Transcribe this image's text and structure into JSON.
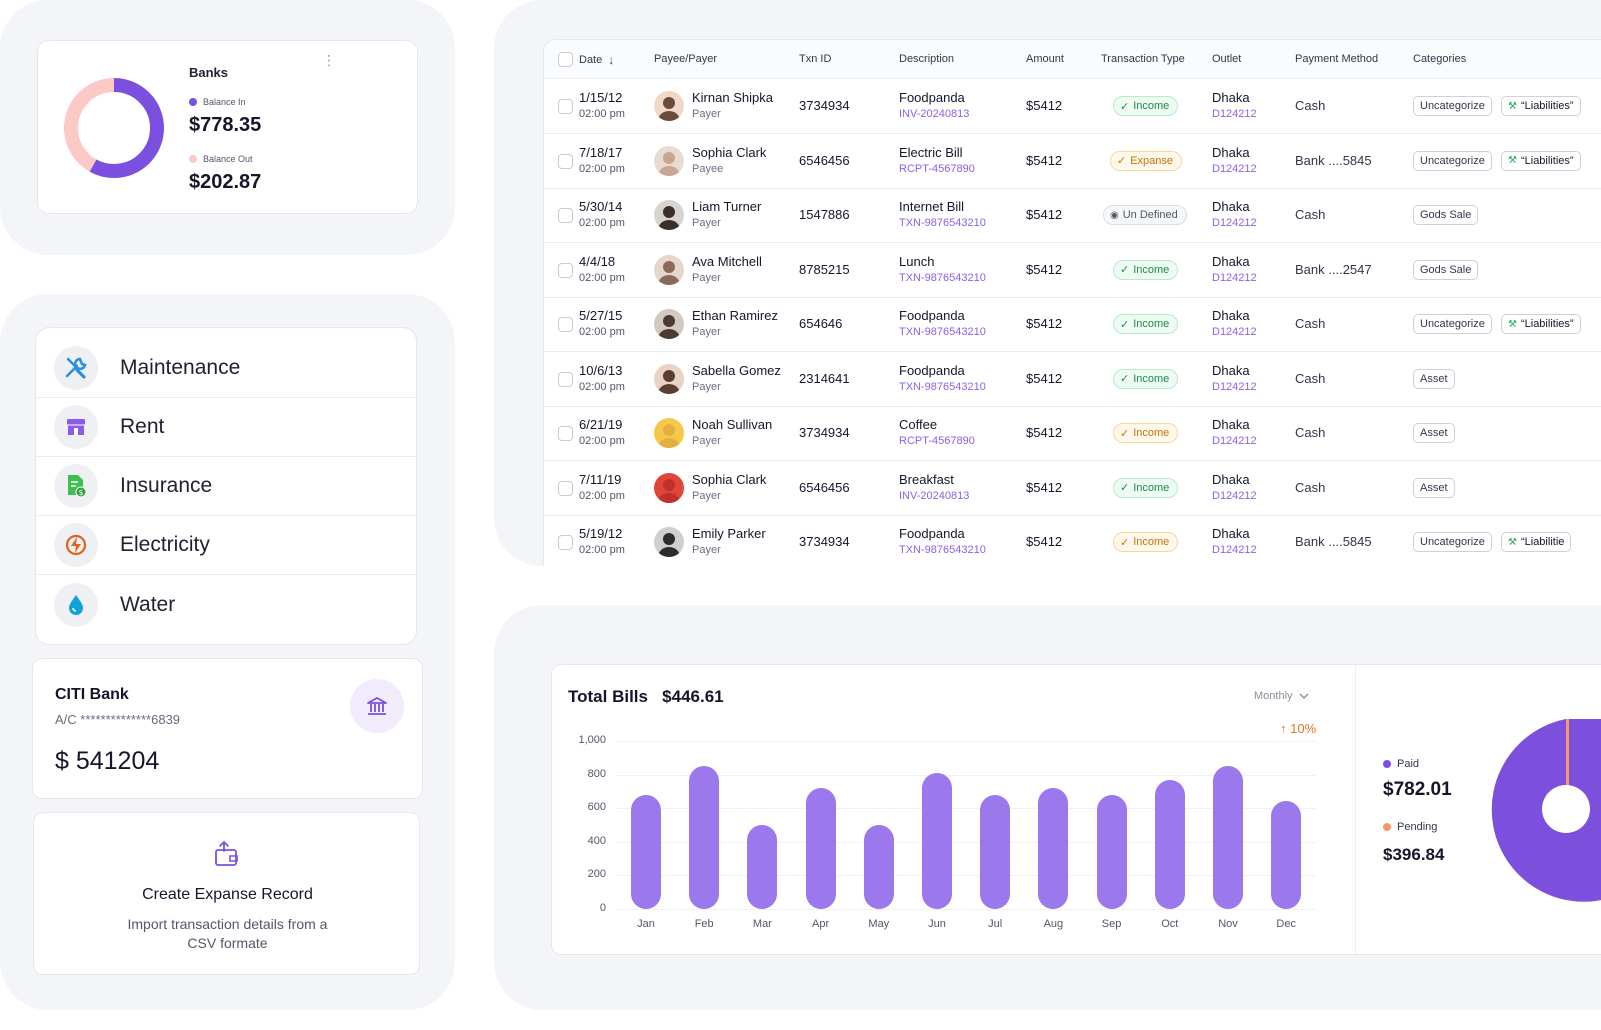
{
  "banks": {
    "title": "Banks",
    "balance_in_label": "Balance In",
    "balance_in": "$778.35",
    "balance_out_label": "Balance Out",
    "balance_out": "$202.87",
    "colors": {
      "in": "#7b50e0",
      "out": "#fcc9c6"
    },
    "in_share": 0.58
  },
  "categories": [
    {
      "label": "Maintenance",
      "icon": "tools-icon"
    },
    {
      "label": "Rent",
      "icon": "store-icon"
    },
    {
      "label": "Insurance",
      "icon": "document-dollar-icon"
    },
    {
      "label": "Electricity",
      "icon": "lightning-icon"
    },
    {
      "label": "Water",
      "icon": "water-drop-icon"
    }
  ],
  "bank_account": {
    "name": "CITI Bank",
    "account": "A/C **************6839",
    "balance": "$ 541204",
    "icon": "bank-icon"
  },
  "create_record": {
    "title": "Create Expanse Record",
    "description_line1": "Import transaction details from a",
    "description_line2": "CSV formate",
    "icon": "wallet-upload-icon"
  },
  "table": {
    "headers": {
      "date": "Date",
      "payee": "Payee/Payer",
      "txn": "Txn ID",
      "description": "Description",
      "amount": "Amount",
      "type": "Transaction Type",
      "outlet": "Outlet",
      "payment": "Payment Method",
      "categories": "Categories"
    },
    "rows": [
      {
        "date": "1/15/12",
        "time": "02:00 pm",
        "name": "Kirnan Shipka",
        "role": "Payer",
        "txn": "3734934",
        "desc": "Foodpanda",
        "ref": "INV-20240813",
        "amount": "$5412",
        "type": "Income",
        "type_style": "income",
        "outlet": "Dhaka",
        "outlet_code": "D124212",
        "payment": "Cash",
        "cat1": "Uncategorize",
        "cat2": "“Liabilities”"
      },
      {
        "date": "7/18/17",
        "time": "02:00 pm",
        "name": "Sophia Clark",
        "role": "Payee",
        "txn": "6546456",
        "desc": "Electric Bill",
        "ref": "RCPT-4567890",
        "amount": "$5412",
        "type": "Expanse",
        "type_style": "expense",
        "outlet": "Dhaka",
        "outlet_code": "D124212",
        "payment": "Bank ....5845",
        "cat1": "Uncategorize",
        "cat2": "“Liabilities”"
      },
      {
        "date": "5/30/14",
        "time": "02:00 pm",
        "name": "Liam Turner",
        "role": "Payer",
        "txn": "1547886",
        "desc": "Internet Bill",
        "ref": "TXN-9876543210",
        "amount": "$5412",
        "type": "Un Defined",
        "type_style": "undef",
        "outlet": "Dhaka",
        "outlet_code": "D124212",
        "payment": "Cash",
        "cat1": "Gods Sale",
        "cat2": ""
      },
      {
        "date": "4/4/18",
        "time": "02:00 pm",
        "name": "Ava Mitchell",
        "role": "Payer",
        "txn": "8785215",
        "desc": "Lunch",
        "ref": "TXN-9876543210",
        "amount": "$5412",
        "type": "Income",
        "type_style": "income",
        "outlet": "Dhaka",
        "outlet_code": "D124212",
        "payment": "Bank ....2547",
        "cat1": "Gods Sale",
        "cat2": ""
      },
      {
        "date": "5/27/15",
        "time": "02:00 pm",
        "name": "Ethan Ramirez",
        "role": "Payer",
        "txn": "654646",
        "desc": "Foodpanda",
        "ref": "TXN-9876543210",
        "amount": "$5412",
        "type": "Income",
        "type_style": "income",
        "outlet": "Dhaka",
        "outlet_code": "D124212",
        "payment": "Cash",
        "cat1": "Uncategorize",
        "cat2": "“Liabilities”"
      },
      {
        "date": "10/6/13",
        "time": "02:00 pm",
        "name": "Sabella Gomez",
        "role": "Payer",
        "txn": "2314641",
        "desc": "Foodpanda",
        "ref": "TXN-9876543210",
        "amount": "$5412",
        "type": "Income",
        "type_style": "income",
        "outlet": "Dhaka",
        "outlet_code": "D124212",
        "payment": "Cash",
        "cat1": "Asset",
        "cat2": ""
      },
      {
        "date": "6/21/19",
        "time": "02:00 pm",
        "name": "Noah Sullivan",
        "role": "Payer",
        "txn": "3734934",
        "desc": "Coffee",
        "ref": "RCPT-4567890",
        "amount": "$5412",
        "type": "Income",
        "type_style": "income-y",
        "outlet": "Dhaka",
        "outlet_code": "D124212",
        "payment": "Cash",
        "cat1": "Asset",
        "cat2": ""
      },
      {
        "date": "7/11/19",
        "time": "02:00 pm",
        "name": "Sophia Clark",
        "role": "Payer",
        "txn": "6546456",
        "desc": "Breakfast",
        "ref": "INV-20240813",
        "amount": "$5412",
        "type": "Income",
        "type_style": "income",
        "outlet": "Dhaka",
        "outlet_code": "D124212",
        "payment": "Cash",
        "cat1": "Asset",
        "cat2": ""
      },
      {
        "date": "5/19/12",
        "time": "02:00 pm",
        "name": "Emily Parker",
        "role": "Payer",
        "txn": "3734934",
        "desc": "Foodpanda",
        "ref": "TXN-9876543210",
        "amount": "$5412",
        "type": "Income",
        "type_style": "income-y",
        "outlet": "Dhaka",
        "outlet_code": "D124212",
        "payment": "Bank ....5845",
        "cat1": "Uncategorize",
        "cat2": "“Liabilitie"
      }
    ]
  },
  "bills": {
    "title": "Total Bills",
    "total": "$446.61",
    "period": "Monthly",
    "growth": "10%",
    "paid_label": "Paid",
    "paid": "$782.01",
    "pending_label": "Pending",
    "pending": "$396.84",
    "colors": {
      "bar": "#9b79ec",
      "paid": "#7b50e0",
      "pending": "#f79a66"
    }
  },
  "chart_data": {
    "type": "bar",
    "title": "Total Bills",
    "xlabel": "",
    "ylabel": "",
    "categories": [
      "Jan",
      "Feb",
      "Mar",
      "Apr",
      "May",
      "Jun",
      "Jul",
      "Aug",
      "Sep",
      "Oct",
      "Nov",
      "Dec"
    ],
    "values": [
      680,
      850,
      500,
      720,
      500,
      810,
      680,
      720,
      680,
      770,
      850,
      640
    ],
    "ylim": [
      0,
      1000
    ],
    "yticks": [
      0,
      200,
      400,
      600,
      800,
      1000
    ],
    "ytick_labels": [
      "0",
      "200",
      "400",
      "600",
      "800",
      "1,000"
    ],
    "grid": true
  }
}
